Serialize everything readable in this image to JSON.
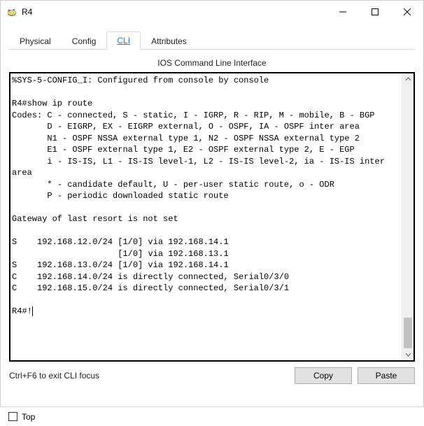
{
  "window": {
    "title": "R4"
  },
  "tabs": {
    "physical": "Physical",
    "config": "Config",
    "cli": "CLI",
    "attributes": "Attributes"
  },
  "cli": {
    "heading": "IOS Command Line Interface",
    "output": "%SYS-5-CONFIG_I: Configured from console by console\n\nR4#show ip route\nCodes: C - connected, S - static, I - IGRP, R - RIP, M - mobile, B - BGP\n       D - EIGRP, EX - EIGRP external, O - OSPF, IA - OSPF inter area\n       N1 - OSPF NSSA external type 1, N2 - OSPF NSSA external type 2\n       E1 - OSPF external type 1, E2 - OSPF external type 2, E - EGP\n       i - IS-IS, L1 - IS-IS level-1, L2 - IS-IS level-2, ia - IS-IS inter area\n       * - candidate default, U - per-user static route, o - ODR\n       P - periodic downloaded static route\n\nGateway of last resort is not set\n\nS    192.168.12.0/24 [1/0] via 192.168.14.1\n                     [1/0] via 192.168.13.1\nS    192.168.13.0/24 [1/0] via 192.168.14.1\nC    192.168.14.0/24 is directly connected, Serial0/3/0\nC    192.168.15.0/24 is directly connected, Serial0/3/1\n\nR4#!",
    "hint": "Ctrl+F6 to exit CLI focus",
    "copy": "Copy",
    "paste": "Paste"
  },
  "footer": {
    "top": "Top"
  }
}
